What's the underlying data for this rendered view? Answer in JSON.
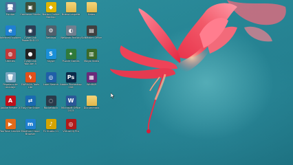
{
  "desktop": {
    "icons": [
      {
        "label": "Equipo",
        "glyph": "🖥",
        "icon": "computer-icon",
        "color": "#4a6f9a"
      },
      {
        "label": "Camtasia Studio",
        "glyph": "▣",
        "icon": "camtasia-icon",
        "color": "#3d4f3a"
      },
      {
        "label": "Norton Online Backup",
        "glyph": "◆",
        "icon": "norton-icon",
        "color": "#e0b400"
      },
      {
        "label": "Nueva carpeta",
        "glyph": "",
        "icon": "folder-icon",
        "color": "#e8c15a"
      },
      {
        "label": "Datos",
        "glyph": "",
        "icon": "folder-icon",
        "color": "#e8c15a"
      },
      {
        "label": "Internet Explorer",
        "glyph": "e",
        "icon": "internet-explorer-icon",
        "color": "#1f7fd0"
      },
      {
        "label": "CyberLink PowerDVD 12",
        "glyph": "◉",
        "icon": "powerdvd-icon",
        "color": "#2c3f55"
      },
      {
        "label": "Settings",
        "glyph": "⚙",
        "icon": "gear-icon",
        "color": "#50606c"
      },
      {
        "label": "Network Factory",
        "glyph": "◐",
        "icon": "network-icon",
        "color": "#6f7f8f"
      },
      {
        "label": "SoftMaker Office",
        "glyph": "▤",
        "icon": "app-icon",
        "color": "#404040"
      },
      {
        "label": "Utilities",
        "glyph": "◍",
        "icon": "utilities-icon",
        "color": "#c03a3a"
      },
      {
        "label": "CyberLink YouCam 5",
        "glyph": "●",
        "icon": "youcam-icon",
        "color": "#222"
      },
      {
        "label": "Skype",
        "glyph": "S",
        "icon": "skype-icon",
        "color": "#1a8fd8"
      },
      {
        "label": "Puzzle Games",
        "glyph": "✦",
        "icon": "puzzle-icon",
        "color": "#2f7a3a"
      },
      {
        "label": "Magix Video",
        "glyph": "▥",
        "icon": "video-editor-icon",
        "color": "#3a6a2a"
      },
      {
        "label": "Papelera de reciclaje",
        "glyph": "🗑",
        "icon": "recycle-bin-icon",
        "color": "#7aa6c0"
      },
      {
        "label": "DAEMON Tools Lite",
        "glyph": "ϟ",
        "icon": "daemon-tools-icon",
        "color": "#e0501a"
      },
      {
        "label": "Load Search",
        "glyph": "◎",
        "icon": "search-icon",
        "color": "#1f5fa8"
      },
      {
        "label": "Adobe Photoshop CS6",
        "glyph": "Ps",
        "icon": "photoshop-icon",
        "color": "#0c2a4a"
      },
      {
        "label": "WinRAR",
        "glyph": "▦",
        "icon": "winrar-icon",
        "color": "#6a2a7a"
      },
      {
        "label": "Adobe Reader X",
        "glyph": "A",
        "icon": "adobe-reader-icon",
        "color": "#c0101a"
      },
      {
        "label": "Easy File Share",
        "glyph": "⇄",
        "icon": "file-share-icon",
        "color": "#1a6ab0"
      },
      {
        "label": "Rocketdock",
        "glyph": "◌",
        "icon": "dock-icon",
        "color": "#2a3a4a"
      },
      {
        "label": "Microsoft Office 2013",
        "glyph": "W",
        "icon": "office-icon",
        "color": "#2b5797"
      },
      {
        "label": "Documentos",
        "glyph": "",
        "icon": "folder-icon",
        "color": "#e8c15a"
      },
      {
        "label": "YouTube Catcher",
        "glyph": "▶",
        "icon": "youtube-catcher-icon",
        "color": "#e06a1a"
      },
      {
        "label": "Maxthon Cloud Browser",
        "glyph": "m",
        "icon": "maxthon-icon",
        "color": "#1f7fd0"
      },
      {
        "label": "FL Studio 11",
        "glyph": "♪",
        "icon": "fl-studio-icon",
        "color": "#d4a400"
      },
      {
        "label": "Virtual DJ Pro",
        "glyph": "◎",
        "icon": "virtual-dj-icon",
        "color": "#b01a1a"
      }
    ]
  }
}
